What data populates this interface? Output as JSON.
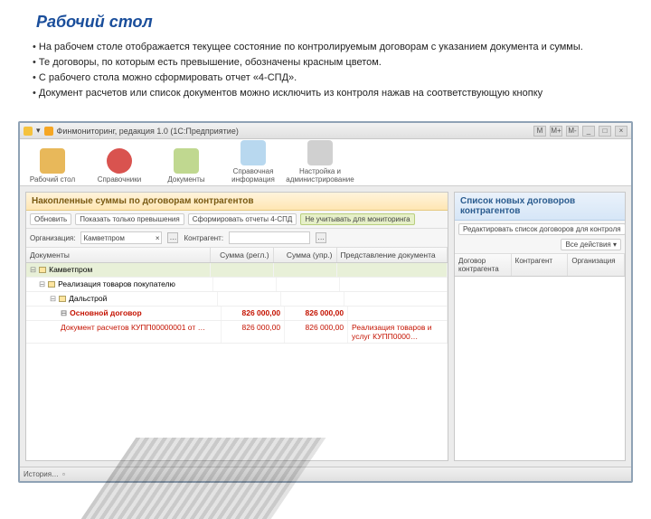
{
  "slide": {
    "title": "Рабочий стол",
    "bullets": [
      "На рабочем столе отображается текущее состояние по контролируемым договорам с указанием    документа и суммы.",
      "Те договоры, по которым есть превышение, обозначены красным цветом.",
      "С рабочего стола можно сформировать отчет «4-СПД».",
      "Документ расчетов или список документов можно исключить из контроля нажав на соответствующую кнопку"
    ]
  },
  "window": {
    "title": "Финмониторинг, редакция 1.0  (1С:Предприятие)",
    "winbtns": [
      "M",
      "M+",
      "M-",
      "_",
      "□",
      "×"
    ]
  },
  "bigbar": {
    "items": [
      {
        "label": "Рабочий стол"
      },
      {
        "label": "Справочники"
      },
      {
        "label": "Документы"
      },
      {
        "label": "Справочная информация"
      },
      {
        "label": "Настройка и администрирование"
      }
    ]
  },
  "left": {
    "title": "Накопленные суммы по договорам контрагентов",
    "toolbar": {
      "refresh": "Обновить",
      "onlyOver": "Показать только превышения",
      "make4spd": "Сформировать отчеты 4-СПД",
      "exclude": "Не учитывать для мониторинга"
    },
    "filters": {
      "orgLabel": "Организация:",
      "orgValue": "Камветпром",
      "contragentLabel": "Контрагент:",
      "contragentValue": ""
    },
    "columns": {
      "docs": "Документы",
      "sumReg": "Сумма (регл.)",
      "sumUpr": "Сумма (упр.)",
      "repr": "Представление документа"
    },
    "rows": [
      {
        "label": "Камветпром",
        "reg": "",
        "upr": "",
        "repr": "",
        "cls": "sel",
        "pad": ""
      },
      {
        "label": "Реализация товаров покупателю",
        "reg": "",
        "upr": "",
        "repr": "",
        "cls": "",
        "pad": "pad1"
      },
      {
        "label": "Дальстрой",
        "reg": "",
        "upr": "",
        "repr": "",
        "cls": "",
        "pad": "pad2"
      },
      {
        "label": "Основной договор",
        "reg": "826 000,00",
        "upr": "826 000,00",
        "repr": "",
        "cls": "row-red",
        "pad": "pad3"
      },
      {
        "label": "Документ расчетов КУПП00000001 от …",
        "reg": "826 000,00",
        "upr": "826 000,00",
        "repr": "Реализация товаров и услуг КУПП0000…",
        "cls": "row-red2",
        "pad": "pad3"
      }
    ]
  },
  "right": {
    "title": "Список новых договоров контрагентов",
    "toolbar": {
      "edit": "Редактировать список договоров для контроля",
      "all": "Все действия ▾"
    },
    "columns": {
      "c1": "Договор контрагента",
      "c2": "Контрагент",
      "c3": "Организация"
    }
  },
  "status": {
    "history": "История…"
  }
}
